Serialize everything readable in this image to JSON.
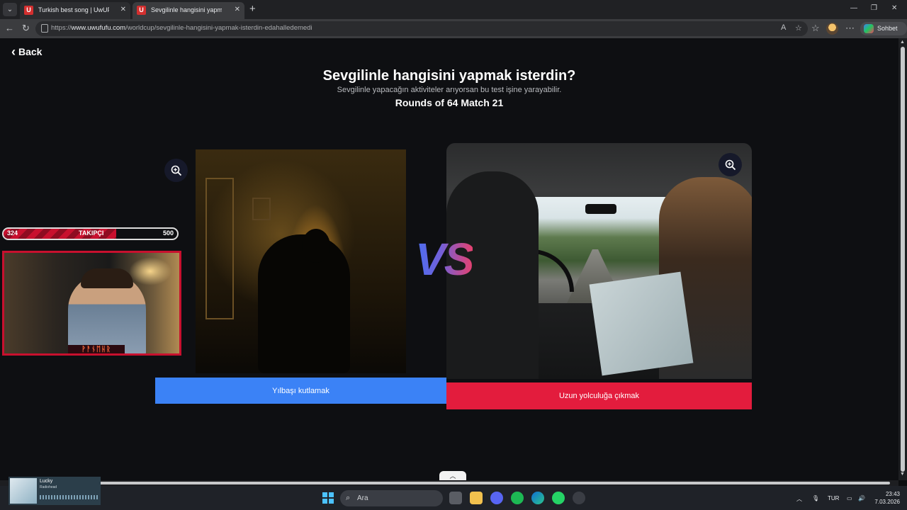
{
  "browser": {
    "tabs": [
      {
        "title": "Turkish best song | UwUFUFU",
        "favicon": "U",
        "active": false
      },
      {
        "title": "Sevgilinle hangisini yapmak isterdin",
        "favicon": "U",
        "active": true
      }
    ],
    "url_scheme": "https://",
    "url_host": "www.uwufufu.com",
    "url_path": "/worldcup/sevgilinle-hangisini-yapmak-isterdin-edahalledemedi",
    "copilot_label": "Sohbet et",
    "icons": {
      "close": "close-icon",
      "new_tab": "plus-icon",
      "back": "arrow-left-icon",
      "reload": "reload-icon"
    }
  },
  "page": {
    "back_label": "Back",
    "title": "Sevgilinle hangisini yapmak isterdin?",
    "subtitle": "Sevgilinle yapacağın aktiviteler arıyorsan bu test işine yarayabilir.",
    "round": "Rounds of 64 Match 21",
    "vs": "VS",
    "left_choice": "Yılbaşı kutlamak",
    "right_choice": "Uzun yolculuğa çıkmak",
    "colors": {
      "left_button": "#3b82f6",
      "right_button": "#e31c3d",
      "background": "#0e0f12"
    }
  },
  "overlay": {
    "follower_current": "324",
    "follower_label": "TAKIPÇI",
    "follower_goal": "500",
    "follower_progress": 0.648,
    "webcam_label": "ᚹᚨᚾᛖᚺᚱ"
  },
  "media": {
    "song": "Lucky",
    "artist": "Radiohead"
  },
  "taskbar": {
    "search_placeholder": "Ara",
    "language": "TUR",
    "time": "23:43",
    "date": "7.03.2026"
  }
}
